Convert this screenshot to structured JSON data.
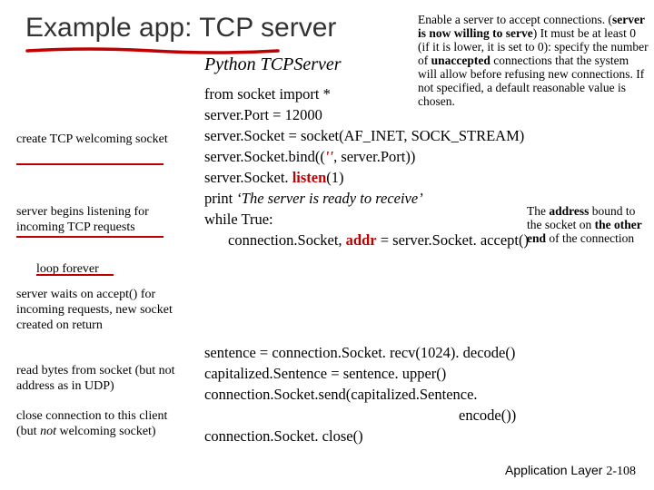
{
  "title": "Example app: TCP server",
  "subtitle": "Python TCPServer",
  "code_block_1": {
    "l0": "from socket import *",
    "l1": "server.Port = 12000",
    "l2": "server.Socket = socket(AF_INET, SOCK_STREAM)",
    "l3a": "server.Socket.bind((",
    "l3b": "''",
    "l3c": ", server.Port))",
    "l4a": "server.Socket. ",
    "l4b": "listen",
    "l4c": "(1)",
    "l5a": "print ",
    "l5b": "‘The server is ready to receive’",
    "l6": "while True:",
    "l7a": "connection.Socket, ",
    "l7b": "addr",
    "l7c": " = server.Socket. accept()"
  },
  "code_block_2": {
    "l0": "sentence = connection.Socket. recv(1024). decode()",
    "l1": "capitalized.Sentence = sentence. upper()",
    "l2": "connection.Socket.send(capitalized.Sentence.",
    "l3": "encode())",
    "l4": "connection.Socket. close()"
  },
  "left_notes": {
    "n1": "create TCP welcoming socket",
    "n2": "server begins listening for incoming TCP requests",
    "n3": "loop forever",
    "n4": "server waits on accept() for incoming requests, new socket created on return",
    "n5": "read bytes from socket (but not address as in UDP)",
    "n6a": "close connection to this client (but ",
    "n6b": "not",
    "n6c": " welcoming socket)"
  },
  "right_notes": {
    "n1a": "Enable a server to accept connections. (",
    "n1b": "server is now willing to serve",
    "n1c": ") It must be at least 0 (if it is lower, it is set to 0): specify the number of ",
    "n1d": "unaccepted",
    "n1e": " connections that the system will allow before refusing new connections. If not specified, a default reasonable value is chosen.",
    "n2a": "The ",
    "n2b": "address",
    "n2c": " bound to the socket on ",
    "n2d": "the other end",
    "n2e": " of the connection"
  },
  "footer_label": "Application Layer",
  "footer_page": "2-108"
}
